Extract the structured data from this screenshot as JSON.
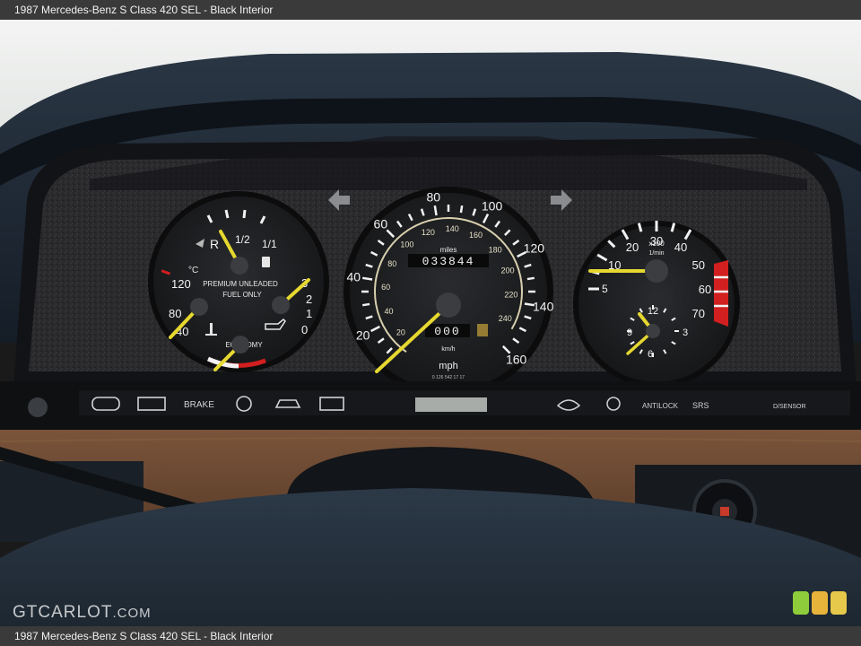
{
  "caption": "1987 Mercedes-Benz S Class 420 SEL - Black Interior",
  "watermark": {
    "brand": "GTCARLOT",
    "suffix": ".COM"
  },
  "fuel_gauge": {
    "fuel_marks": [
      "R",
      "1/2",
      "1/1"
    ],
    "fuel_text_1": "PREMIUM UNLEADED",
    "fuel_text_2": "FUEL ONLY",
    "temp_unit": "°C",
    "temp_marks": [
      "120",
      "80",
      "40"
    ],
    "oil_marks": [
      "3",
      "2",
      "1",
      "0"
    ],
    "economy_label": "ECONOMY"
  },
  "speedometer": {
    "mph_marks": [
      "20",
      "40",
      "60",
      "80",
      "100",
      "120",
      "140",
      "160"
    ],
    "kmh_marks": [
      "20",
      "40",
      "60",
      "80",
      "100",
      "120",
      "140",
      "160",
      "180",
      "200",
      "220",
      "240"
    ],
    "miles_label": "miles",
    "odometer": "033844",
    "trip": "000",
    "kmh_label": "km/h",
    "mph_label": "mph",
    "small_print": "0 126 542 17 17"
  },
  "tachometer": {
    "marks": [
      "10",
      "20",
      "30",
      "40",
      "50",
      "60",
      "70"
    ],
    "inner_5": "5",
    "unit_1": "x100",
    "unit_2": "1/min",
    "clock_marks": [
      "12",
      "3",
      "6",
      "9"
    ]
  },
  "warning_strip": {
    "brake": "BRAKE",
    "antilock": "ANTILOCK",
    "srs": "SRS",
    "sensor": "D/SENSOR"
  },
  "colors": {
    "needle": "#e6d830",
    "redline": "#d21f1f",
    "dial": "#202124",
    "wood": "#6e4a32",
    "badge": [
      "#8fcc3b",
      "#e8b33a",
      "#e6c84a"
    ]
  }
}
